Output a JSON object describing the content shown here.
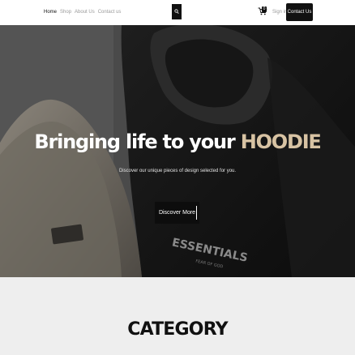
{
  "header": {
    "nav": [
      {
        "label": "Home",
        "active": true
      },
      {
        "label": "Shop",
        "active": false
      },
      {
        "label": "About Us",
        "active": false
      },
      {
        "label": "Contact us",
        "active": false
      }
    ],
    "search_icon": "search-icon",
    "cart_icon": "cart-icon",
    "cart_count": "0",
    "signin_label": "Sign in",
    "contact_button": "Contact Us"
  },
  "hero": {
    "title_main": "Bringing life to your ",
    "title_accent": "HOODIE",
    "subtitle": "Discover our unique pieces of design selected for you.",
    "button": "Discover More",
    "print_brand": "ESSENTIALS",
    "print_tagline": "FEAR OF GOD"
  },
  "category": {
    "title": "CATEGORY"
  },
  "colors": {
    "accent": "#d8c3a3",
    "dark": "#111111",
    "section_bg": "#eeeeee"
  }
}
